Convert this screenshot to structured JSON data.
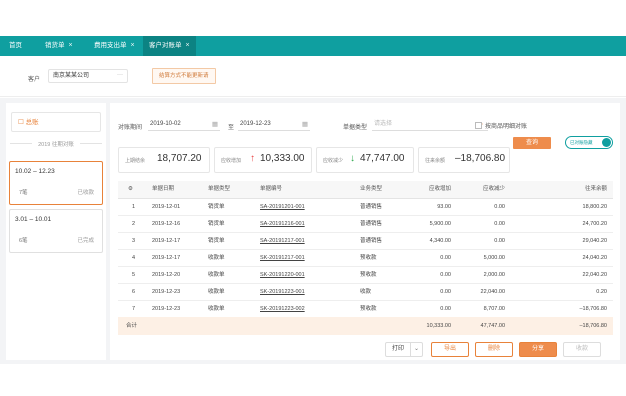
{
  "tabs": [
    {
      "label": "首页",
      "closable": false
    },
    {
      "label": "销货单",
      "closable": true
    },
    {
      "label": "费用支出单",
      "closable": true
    },
    {
      "label": "客户对账单",
      "closable": true,
      "active": true
    }
  ],
  "filter": {
    "customer_label": "客户",
    "customer_value": "南京某某公司",
    "customer_more": "···",
    "notice": "结算方式不能更新请"
  },
  "left": {
    "ledger_button": "总账",
    "period_heading": "2019 往期对账",
    "periods": [
      {
        "dates": "10.02 – 12.23",
        "count": "7笔",
        "status": "已收款",
        "selected": true
      },
      {
        "dates": "3.01 – 10.01",
        "count": "6笔",
        "status": "已完成",
        "selected": false
      }
    ]
  },
  "query": {
    "date_label": "对账期间",
    "start_date": "2019-10-02",
    "date_sep": "至",
    "end_date": "2019-12-23",
    "type_label": "单据类型",
    "type_placeholder": "请选择",
    "check_label": "按商品明细对账",
    "query_button": "查询",
    "toggle_label": "已对账隐藏"
  },
  "summary": [
    {
      "label": "上期结余",
      "value": "18,707.20",
      "trend": ""
    },
    {
      "label": "应收增加",
      "value": "10,333.00",
      "trend": "up"
    },
    {
      "label": "应收减少",
      "value": "47,747.00",
      "trend": "down"
    },
    {
      "label": "往来余额",
      "value": "–18,706.80",
      "trend": ""
    }
  ],
  "table": {
    "headers": [
      "#",
      "单据日期",
      "单据类型",
      "单据编号",
      "业务类型",
      "应收增加",
      "应收减少",
      "往来余额"
    ],
    "rows": [
      [
        "1",
        "2019-12-01",
        "销货单",
        "SA-20191201-001",
        "普通销售",
        "93.00",
        "0.00",
        "18,800.20"
      ],
      [
        "2",
        "2019-12-16",
        "销货单",
        "SA-20191216-001",
        "普通销售",
        "5,900.00",
        "0.00",
        "24,700.20"
      ],
      [
        "3",
        "2019-12-17",
        "销货单",
        "SA-20191217-001",
        "普通销售",
        "4,340.00",
        "0.00",
        "29,040.20"
      ],
      [
        "4",
        "2019-12-17",
        "收款单",
        "SK-20191217-001",
        "预收款",
        "0.00",
        "5,000.00",
        "24,040.20"
      ],
      [
        "5",
        "2019-12-20",
        "收款单",
        "SK-20191220-001",
        "预收款",
        "0.00",
        "2,000.00",
        "22,040.20"
      ],
      [
        "6",
        "2019-12-23",
        "收款单",
        "SK-20191223-001",
        "收款",
        "0.00",
        "22,040.00",
        "0.20"
      ],
      [
        "7",
        "2019-12-23",
        "收款单",
        "SK-20191223-002",
        "预收款",
        "0.00",
        "8,707.00",
        "–18,706.80"
      ]
    ],
    "footer": {
      "label": "合计",
      "inc": "10,333.00",
      "dec": "47,747.00",
      "bal": "–18,706.80"
    }
  },
  "bottom": {
    "page_size": "打印",
    "buttons": [
      "导出",
      "删除",
      "分享",
      "收款"
    ]
  }
}
